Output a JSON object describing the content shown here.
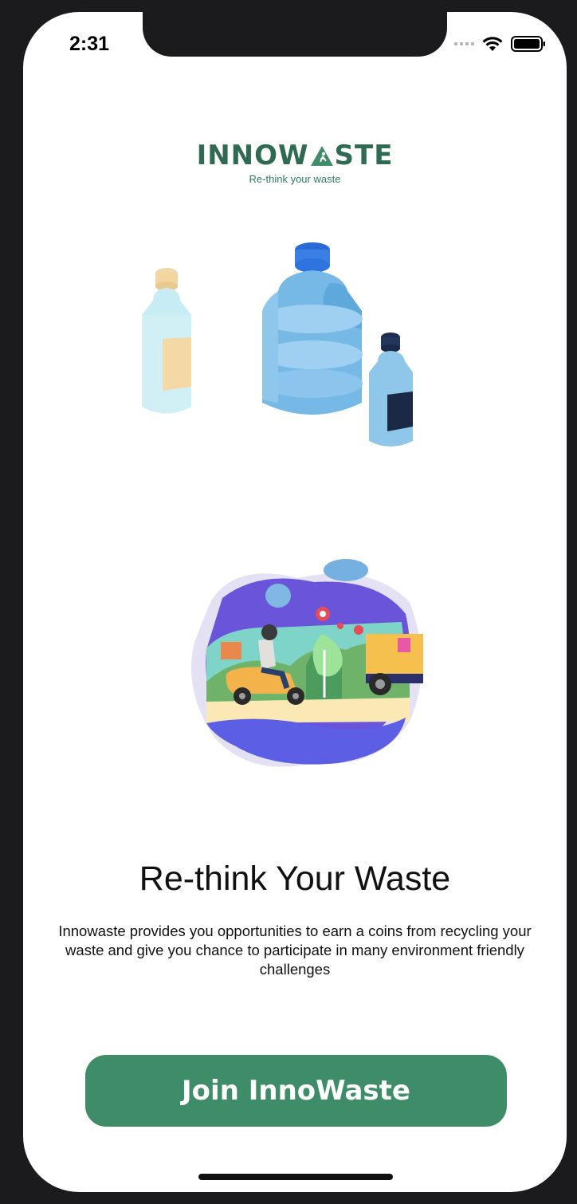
{
  "status_bar": {
    "time": "2:31"
  },
  "logo": {
    "name_left": "INNOW",
    "name_right": "STE",
    "tagline": "Re-think your waste"
  },
  "onboarding": {
    "title": "Re-think Your Waste",
    "description": "Innowaste provides you opportunities to earn a coins from recycling your waste and give you chance to participate in many environment friendly challenges"
  },
  "cta": {
    "join_label": "Join InnoWaste"
  },
  "colors": {
    "brand_green": "#3e8d68",
    "logo_green": "#2f6b52",
    "background": "#ffffff"
  },
  "icons": [
    "signal-icon",
    "wifi-icon",
    "battery-icon",
    "recycle-person-icon",
    "bottles-illustration",
    "delivery-illustration"
  ]
}
